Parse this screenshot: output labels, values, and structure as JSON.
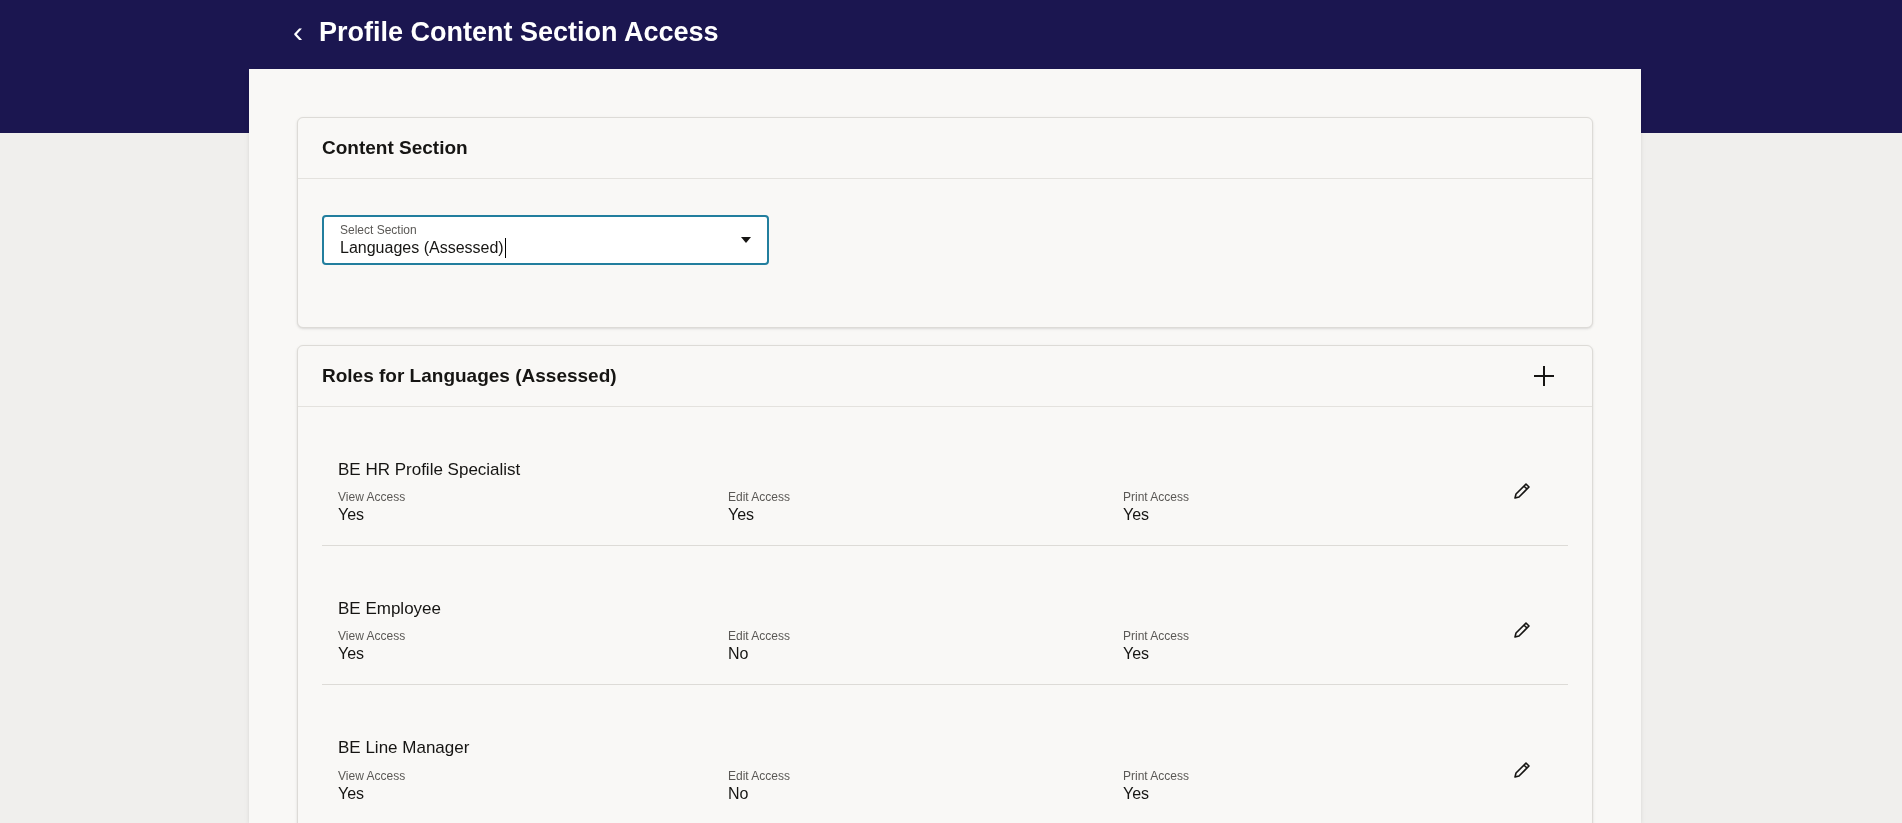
{
  "header": {
    "back_icon": "‹",
    "title": "Profile Content Section Access"
  },
  "content_section": {
    "title": "Content Section",
    "select": {
      "label": "Select Section",
      "value": "Languages (Assessed)"
    }
  },
  "roles": {
    "title": "Roles for Languages (Assessed)",
    "items": [
      {
        "name": "BE HR Profile Specialist",
        "fields": [
          {
            "label": "View Access",
            "value": "Yes"
          },
          {
            "label": "Edit Access",
            "value": "Yes"
          },
          {
            "label": "Print Access",
            "value": "Yes"
          }
        ]
      },
      {
        "name": "BE Employee",
        "fields": [
          {
            "label": "View Access",
            "value": "Yes"
          },
          {
            "label": "Edit Access",
            "value": "No"
          },
          {
            "label": "Print Access",
            "value": "Yes"
          }
        ]
      },
      {
        "name": "BE Line Manager",
        "fields": [
          {
            "label": "View Access",
            "value": "Yes"
          },
          {
            "label": "Edit Access",
            "value": "No"
          },
          {
            "label": "Print Access",
            "value": "Yes"
          }
        ]
      }
    ]
  }
}
